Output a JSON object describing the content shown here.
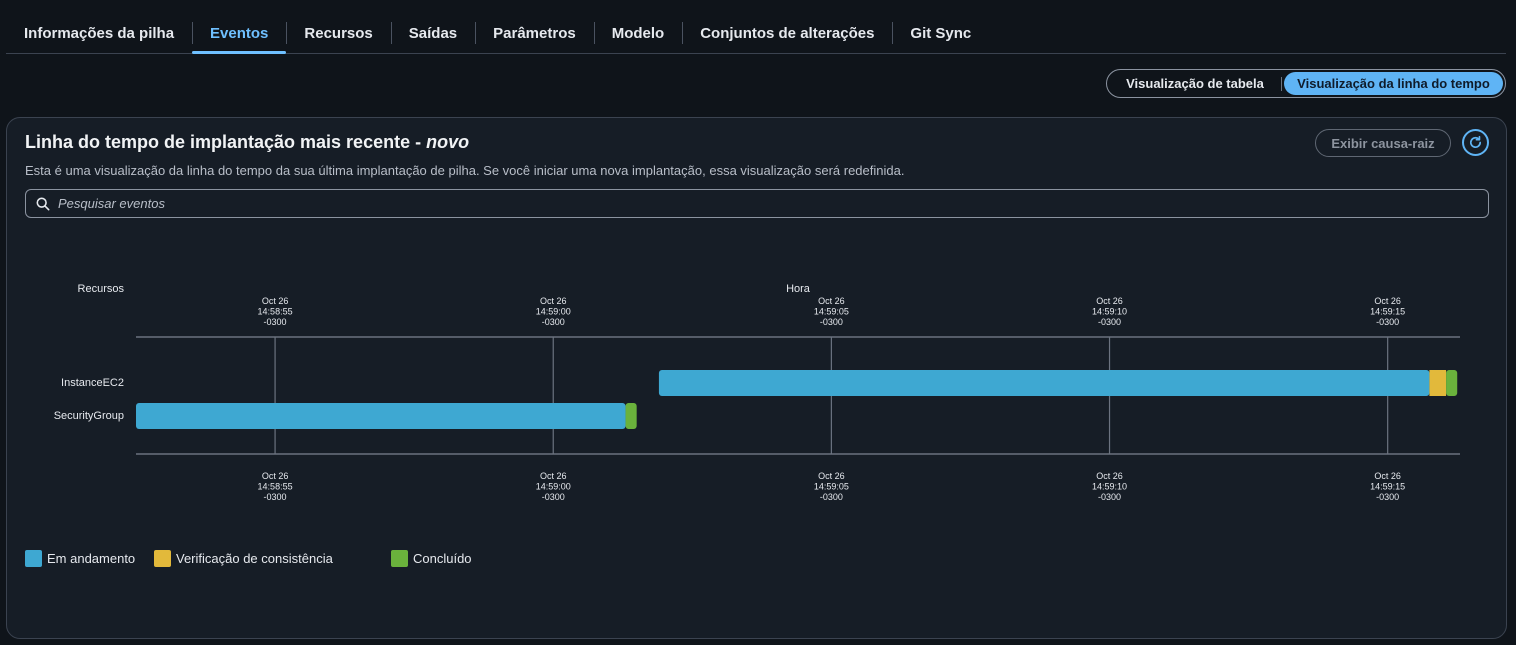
{
  "tabs": [
    {
      "label": "Informações da pilha",
      "active": false
    },
    {
      "label": "Eventos",
      "active": true
    },
    {
      "label": "Recursos",
      "active": false
    },
    {
      "label": "Saídas",
      "active": false
    },
    {
      "label": "Parâmetros",
      "active": false
    },
    {
      "label": "Modelo",
      "active": false
    },
    {
      "label": "Conjuntos de alterações",
      "active": false
    },
    {
      "label": "Git Sync",
      "active": false
    }
  ],
  "view_toggle": {
    "table_label": "Visualização de tabela",
    "timeline_label": "Visualização da linha do tempo",
    "selected": "timeline"
  },
  "panel": {
    "title": "Linha do tempo de implantação mais recente - ",
    "title_badge": "novo",
    "description": "Esta é uma visualização da linha do tempo da sua última implantação de pilha. Se você iniciar uma nova implantação, essa visualização será redefinida.",
    "root_cause_label": "Exibir causa-raiz",
    "refresh_icon": "refresh-icon",
    "search_icon": "search-icon",
    "search_placeholder": "Pesquisar eventos"
  },
  "colors": {
    "in_progress": "#3ea8d2",
    "consistency_check": "#e2b93b",
    "complete": "#6ab23c",
    "accent": "#5fb4f5"
  },
  "chart_data": {
    "type": "timeline",
    "row_axis_label": "Recursos",
    "time_axis_label": "Hora",
    "ticks": [
      {
        "t": 0,
        "label": [
          "Oct 26",
          "14:58:55",
          "-0300"
        ]
      },
      {
        "t": 5,
        "label": [
          "Oct 26",
          "14:59:00",
          "-0300"
        ]
      },
      {
        "t": 10,
        "label": [
          "Oct 26",
          "14:59:05",
          "-0300"
        ]
      },
      {
        "t": 15,
        "label": [
          "Oct 26",
          "14:59:10",
          "-0300"
        ]
      },
      {
        "t": 20,
        "label": [
          "Oct 26",
          "14:59:15",
          "-0300"
        ]
      }
    ],
    "x_range": [
      -2.5,
      21.3
    ],
    "rows": [
      {
        "resource": "InstanceEC2",
        "segments": [
          {
            "status": "in_progress",
            "start": 6.9,
            "end": 20.75
          },
          {
            "status": "consistency_check",
            "start": 20.75,
            "end": 21.05
          },
          {
            "status": "complete",
            "start": 21.05,
            "end": 21.25
          }
        ]
      },
      {
        "resource": "SecurityGroup",
        "segments": [
          {
            "status": "in_progress",
            "start": -2.5,
            "end": 6.3
          },
          {
            "status": "complete",
            "start": 6.3,
            "end": 6.5
          }
        ]
      }
    ],
    "legend": [
      {
        "status": "in_progress",
        "label": "Em andamento"
      },
      {
        "status": "consistency_check",
        "label": "Verificação de consistência"
      },
      {
        "status": "complete",
        "label": "Concluído"
      }
    ]
  }
}
